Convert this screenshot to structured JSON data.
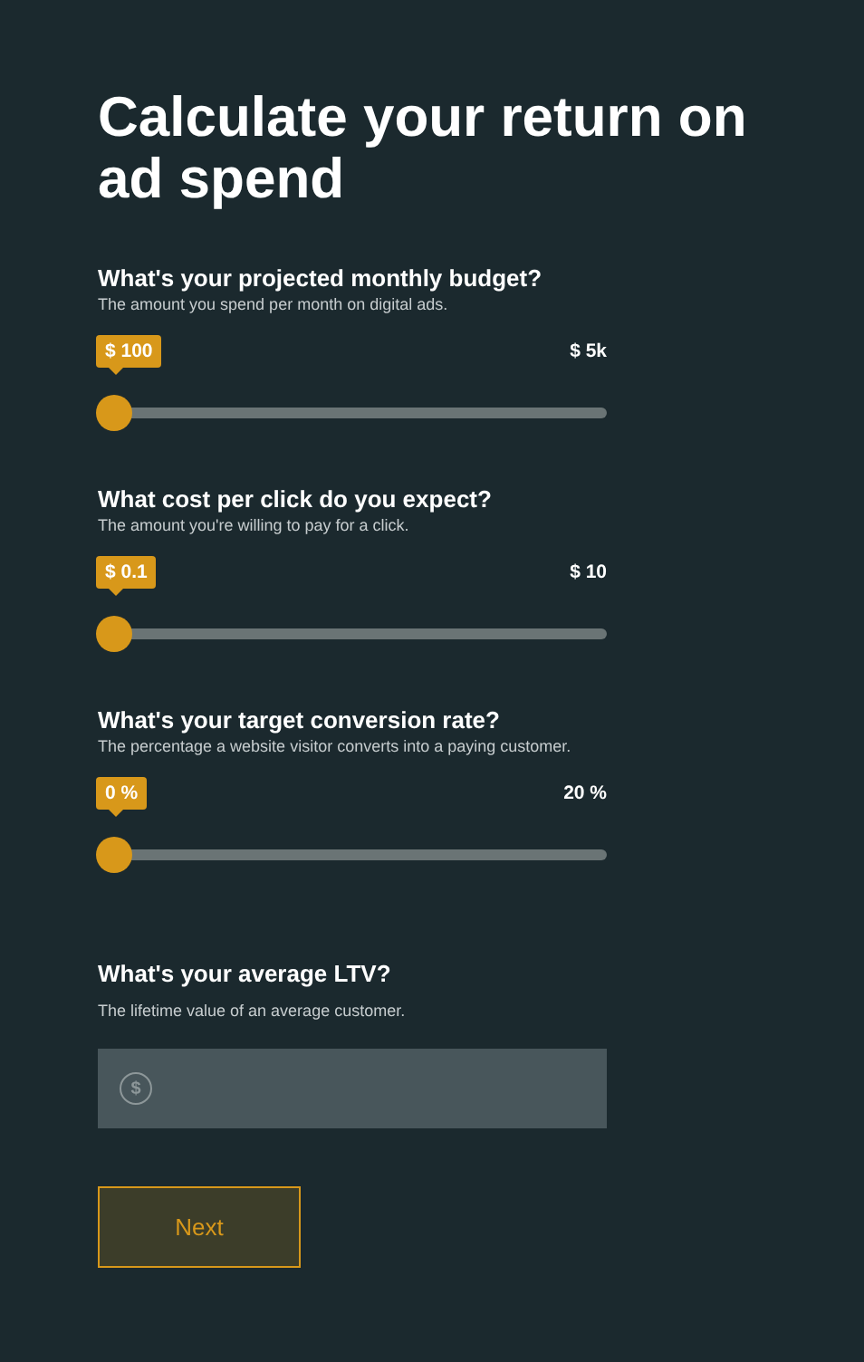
{
  "title": "Calculate your return on ad spend",
  "sliders": [
    {
      "question": "What's your projected monthly budget?",
      "hint": "The amount you spend per month on digital ads.",
      "value": "$ 100",
      "max": "$ 5k",
      "level": 0
    },
    {
      "question": "What cost per click do you expect?",
      "hint": "The amount you're willing to pay for a click.",
      "value": "$ 0.1",
      "max": "$ 10",
      "level": 0
    },
    {
      "question": "What's your target conversion rate?",
      "hint": "The percentage a website visitor converts into a paying customer.",
      "value": "0 %",
      "max": "20 %",
      "level": 0
    }
  ],
  "ltv": {
    "question": "What's your average LTV?",
    "hint": "The lifetime value of an average customer.",
    "icon": "$"
  },
  "button": "Next"
}
